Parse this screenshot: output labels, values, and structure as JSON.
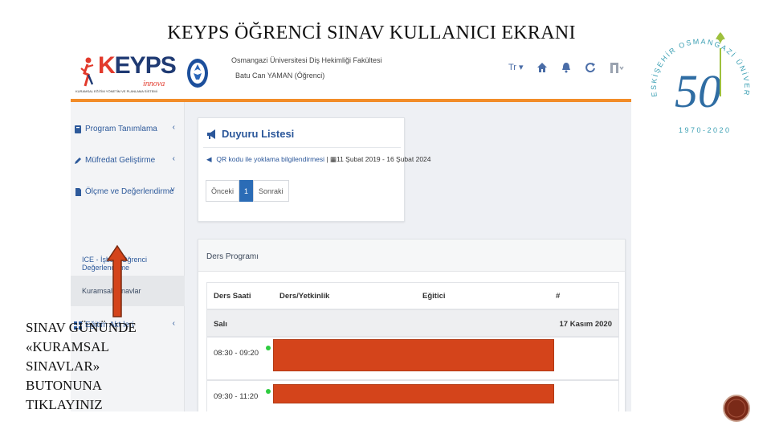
{
  "slide": {
    "title": "KEYPS ÖĞRENCİ SINAV KULLANICI EKRANI",
    "instruction_lines": [
      "SINAV GÜNÜNDE",
      "«KURAMSAL",
      "SINAVLAR»",
      "BUTONUNA",
      "TIKLAYINIZ"
    ]
  },
  "app": {
    "logo_text_k": "K",
    "logo_text_rest": "EYPS",
    "logo_sub": "innova",
    "logo_tagline": "KURAMSAL EĞİTİM YÖNETİM VE PLANLAMA SİSTEMİ",
    "faculty": "Osmangazi Üniversitesi Diş Hekimliği Fakültesi",
    "user": "Batu Can YAMAN (Öğrenci)",
    "language": "Tr ▾",
    "colors": {
      "accent": "#f28c28",
      "link": "#2b579a",
      "redact": "#d4441b"
    }
  },
  "topbar_icons": [
    "home-icon",
    "bell-icon",
    "refresh-icon",
    "user-menu-icon"
  ],
  "sidebar": {
    "items": [
      {
        "label": "Program Tanımlama",
        "icon": "book-icon",
        "chev": "‹"
      },
      {
        "label": "Müfredat Geliştirme",
        "icon": "pencil-icon",
        "chev": "‹"
      },
      {
        "label": "Ölçme ve Değerlendirme",
        "icon": "document-icon",
        "chev": "˅"
      }
    ],
    "subitems": [
      {
        "label": "ICE - İşbaşı Öğrenci Değerlendirme"
      },
      {
        "label": "Kuramsal Sınavlar",
        "active": true
      }
    ],
    "last_item": {
      "label": "Eğitim Akt  leri",
      "icon": "grid-icon",
      "chev": "‹"
    }
  },
  "announcements": {
    "title": "Duyuru Listesi",
    "item_link": "QR kodu ile yoklama bilgilendirmesi",
    "item_date": " | ▦11 Şubat 2019 - 16 Şubat 2024",
    "pager": {
      "prev": "Önceki",
      "current": "1",
      "next": "Sonraki"
    }
  },
  "schedule": {
    "title": "Ders Programı",
    "headers": [
      "Ders Saati",
      "Ders/Yetkinlik",
      "Eğitici",
      "#"
    ],
    "day": "Salı",
    "date": "17 Kasım 2020",
    "slots": [
      {
        "time": "08:30 - 09:20"
      },
      {
        "time": "09:30 - 11:20"
      }
    ]
  },
  "university": {
    "arc_text": "ESKİŞEHİR OSMANGAZİ ÜNİVERSİTESİ",
    "years": "1970-2020",
    "anniversary": "50"
  }
}
